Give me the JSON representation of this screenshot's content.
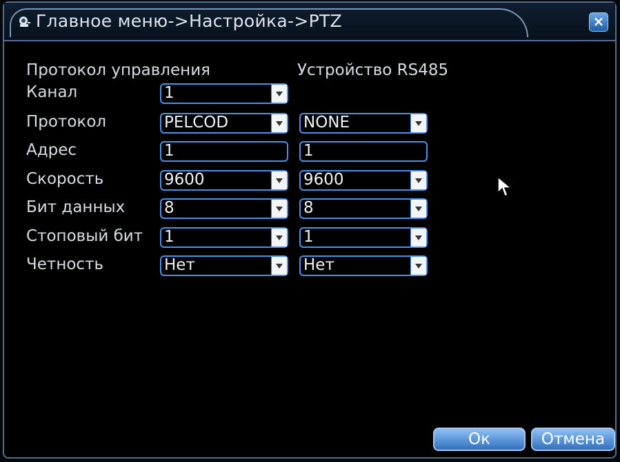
{
  "window": {
    "title": "Главное меню->Настройка->PTZ"
  },
  "headers": {
    "protocol_control": "Протокол управления",
    "rs485_device": "Устройство RS485"
  },
  "rows": [
    {
      "label": "Канал",
      "left": "1",
      "right": null
    },
    {
      "label": "Протокол",
      "left": "PELCOD",
      "right": "NONE"
    },
    {
      "label": "Адрес",
      "left": "1",
      "right": "1"
    },
    {
      "label": "Скорость",
      "left": "9600",
      "right": "9600"
    },
    {
      "label": "Бит данных",
      "left": "8",
      "right": "8"
    },
    {
      "label": "Стоповый бит",
      "left": "1",
      "right": "1"
    },
    {
      "label": "Четность",
      "left": "Нет",
      "right": "Нет"
    }
  ],
  "buttons": {
    "ok": "Ок",
    "cancel": "Отмена"
  },
  "icons": {
    "title": "camera-settings-icon",
    "close": "close-icon",
    "cursor": "mouse-cursor-icon"
  },
  "colors": {
    "accent": "#4c91ea",
    "background": "#000000"
  }
}
